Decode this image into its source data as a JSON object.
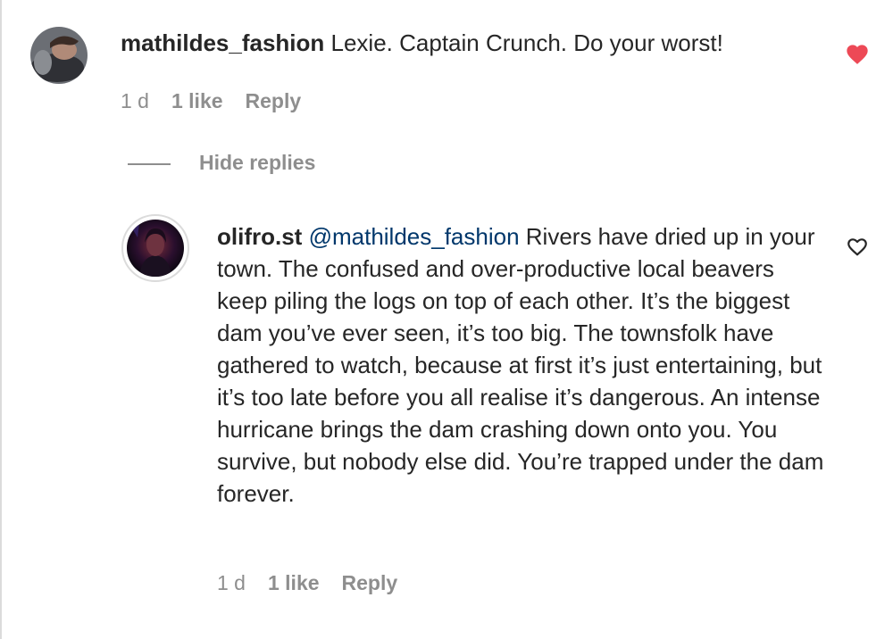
{
  "comment": {
    "username": "mathildes_fashion",
    "text": "Lexie. Captain Crunch. Do your worst!",
    "time": "1 d",
    "likes": "1 like",
    "reply_label": "Reply",
    "liked": true,
    "like_icon": "heart-filled-icon",
    "like_color": "#ed4956"
  },
  "hide_replies_label": "Hide replies",
  "reply": {
    "username": "olifro.st",
    "mention": "@mathildes_fashion",
    "text": "Rivers have dried up in your town. The confused and over-productive local beavers keep piling the logs on top of each other. It’s the biggest dam you’ve ever seen, it’s too big. The townsfolk have gathered to watch, because at first it’s just entertaining, but it’s too late before you all realise it’s dangerous. An intense hurricane brings the dam crashing down onto you. You survive, but nobody else did. You’re trapped under the dam forever.",
    "time": "1 d",
    "likes": "1 like",
    "reply_label": "Reply",
    "liked": false,
    "like_icon": "heart-outline-icon"
  },
  "colors": {
    "text": "#262626",
    "secondary": "#8e8e8e",
    "mention": "#00376b",
    "heart": "#ed4956"
  }
}
